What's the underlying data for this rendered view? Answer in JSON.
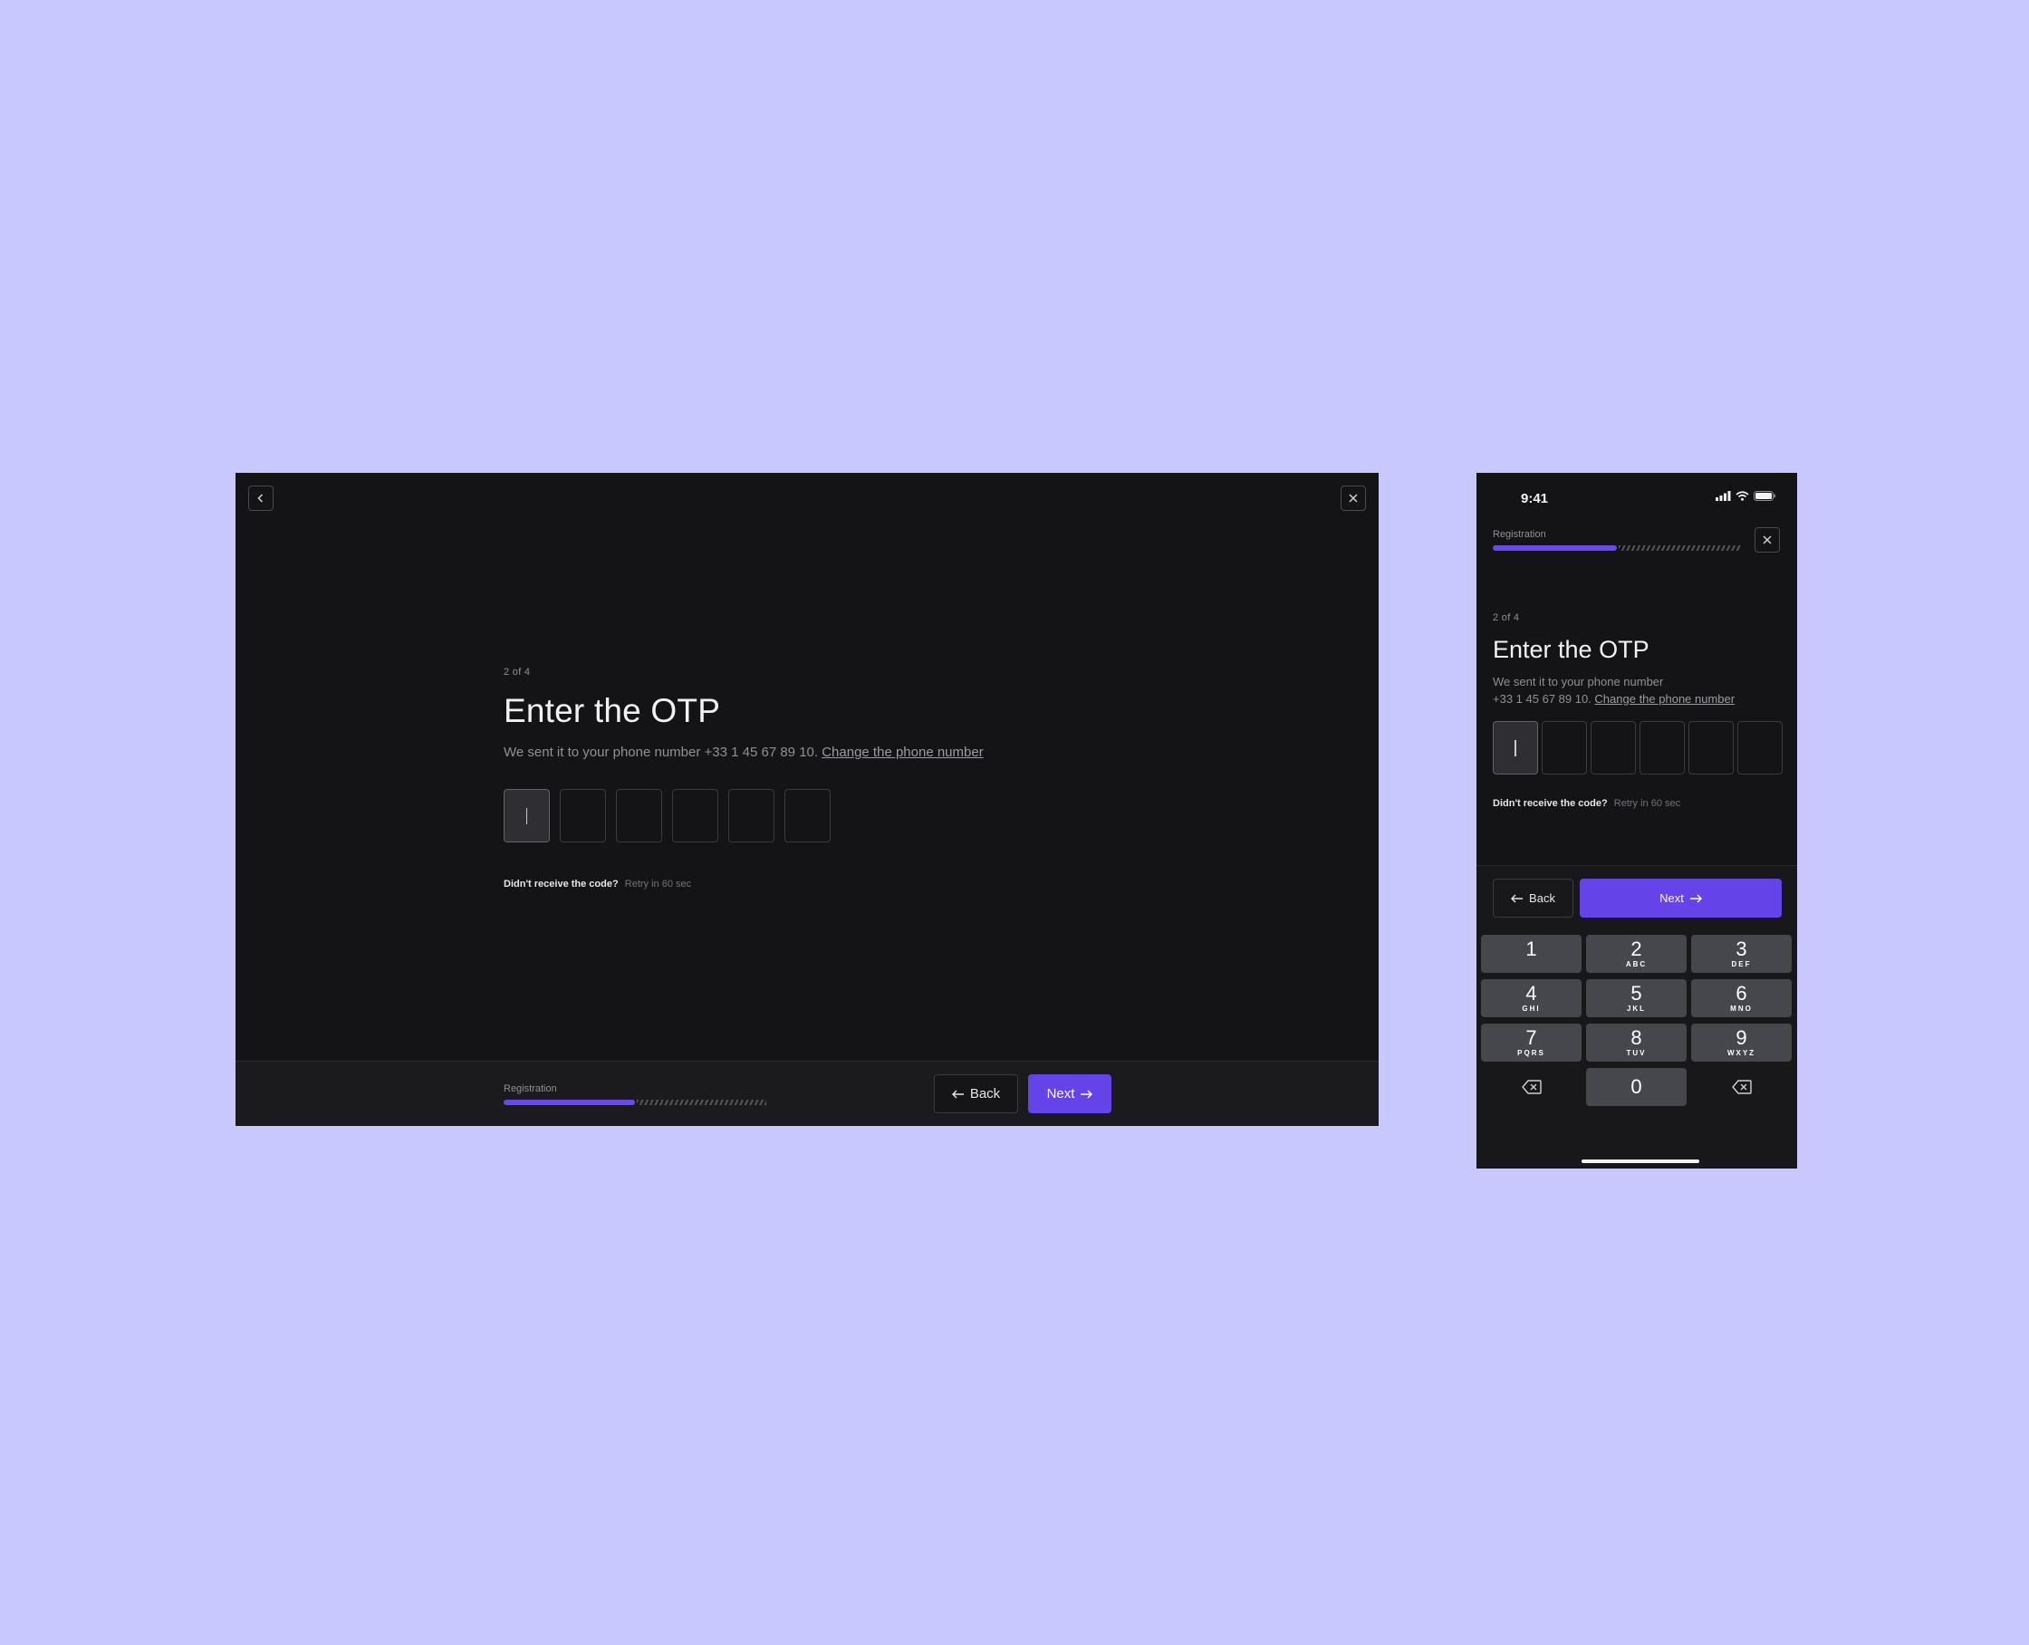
{
  "desktop": {
    "step": "2 of 4",
    "title": "Enter the OTP",
    "subtitle": "We sent it to your phone number +33 1 45 67 89 10.",
    "change_link": "Change the phone number",
    "resend_question": "Didn't receive the code?",
    "resend_timer": "Retry in 60 sec",
    "progress_label": "Registration",
    "progress_fraction": 0.5,
    "back_label": "Back",
    "next_label": "Next"
  },
  "mobile": {
    "time": "9:41",
    "progress_label": "Registration",
    "progress_fraction": 0.5,
    "step": "2 of 4",
    "title": "Enter the OTP",
    "subtitle_line1": "We sent it to your phone number",
    "subtitle_line2": "+33 1 45 67 89 10.",
    "change_link": "Change the phone number",
    "resend_question": "Didn't receive the code?",
    "resend_timer": "Retry in 60 sec",
    "back_label": "Back",
    "next_label": "Next",
    "keys": [
      {
        "num": "1",
        "letters": ""
      },
      {
        "num": "2",
        "letters": "ABC"
      },
      {
        "num": "3",
        "letters": "DEF"
      },
      {
        "num": "4",
        "letters": "GHI"
      },
      {
        "num": "5",
        "letters": "JKL"
      },
      {
        "num": "6",
        "letters": "MNO"
      },
      {
        "num": "7",
        "letters": "PQRS"
      },
      {
        "num": "8",
        "letters": "TUV"
      },
      {
        "num": "9",
        "letters": "WXYZ"
      },
      {
        "num": "0",
        "letters": ""
      }
    ]
  },
  "colors": {
    "background": "#c9c8fe",
    "accent": "#6443e8",
    "surface": "#141416"
  }
}
